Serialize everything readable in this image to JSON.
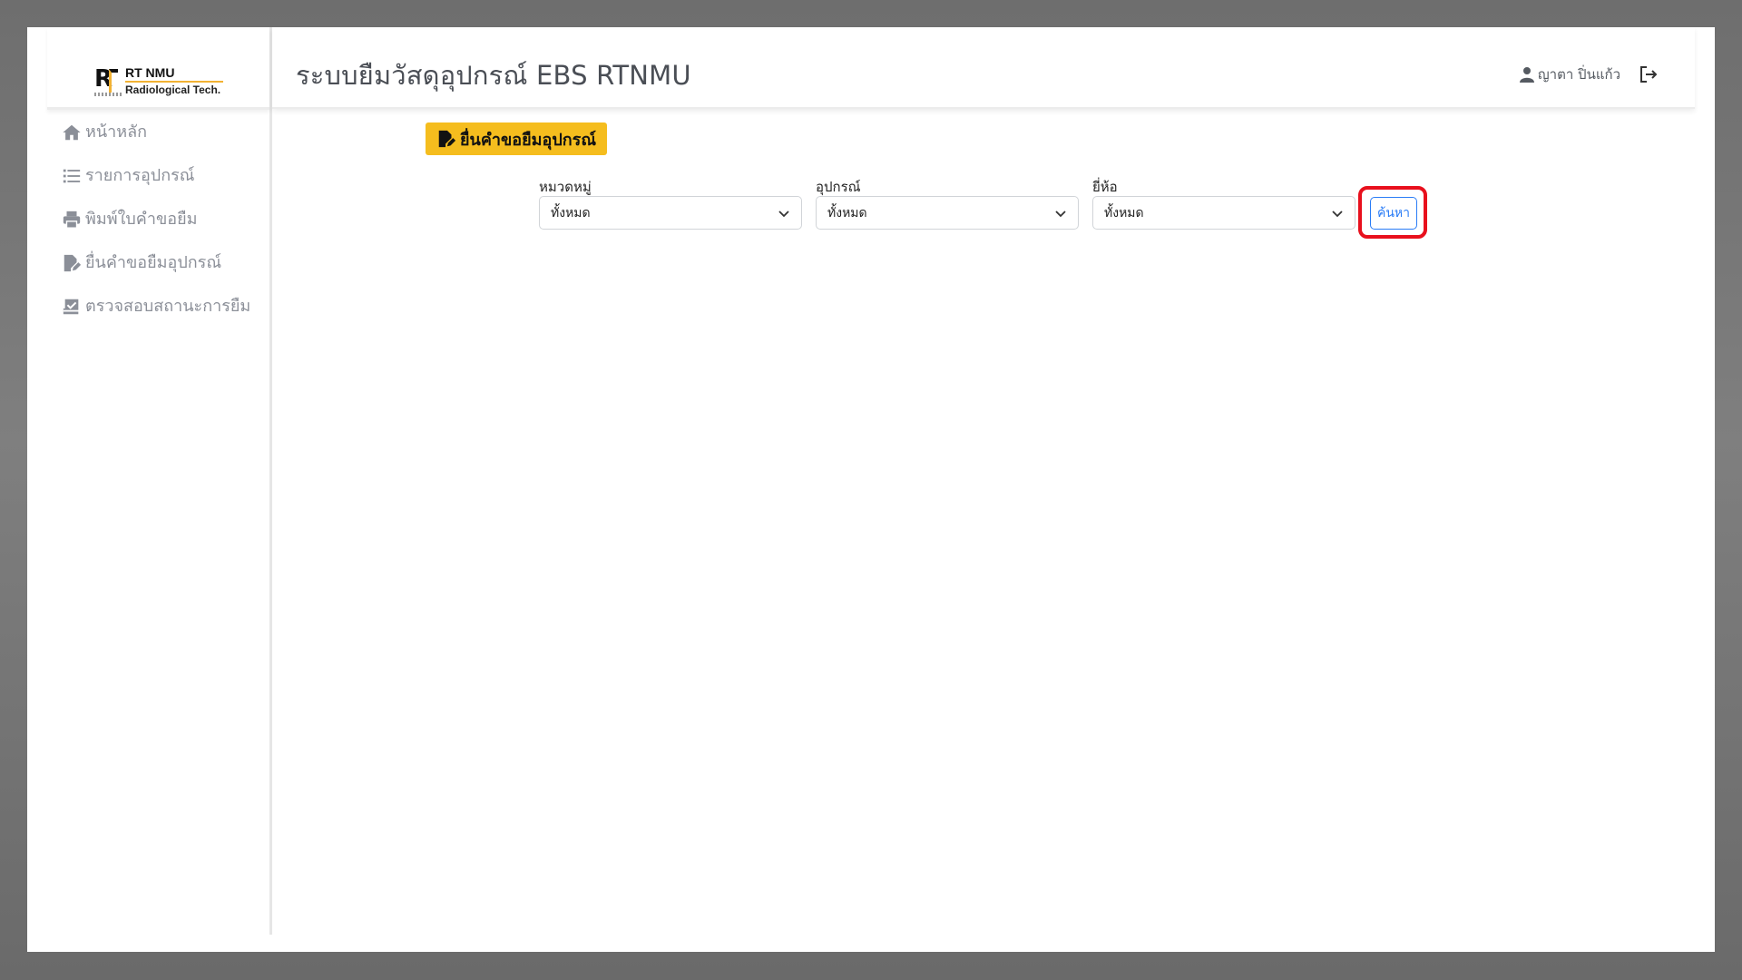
{
  "brand": {
    "title": "RT NMU",
    "subtitle": "Radiological Tech.",
    "accent_color": "#f2b233"
  },
  "sidebar": {
    "items": [
      {
        "label": "หน้าหลัก",
        "icon": "home-icon"
      },
      {
        "label": "รายการอุปกรณ์",
        "icon": "list-icon"
      },
      {
        "label": "พิมพ์ใบคำขอยืม",
        "icon": "printer-icon"
      },
      {
        "label": "ยื่นคำขอยืมอุปกรณ์",
        "icon": "file-edit-icon"
      },
      {
        "label": "ตรวจสอบสถานะการยืม",
        "icon": "inbox-check-icon"
      }
    ]
  },
  "header": {
    "title": "ระบบยืมวัสดุอุปกรณ์ EBS RTNMU",
    "user_name": "ญาตา ปิ่นแก้ว"
  },
  "main": {
    "request_button": "ยื่นคำขอยืมอุปกรณ์",
    "request_button_color": "#f5bd1e",
    "filters": [
      {
        "label": "หมวดหมู่",
        "value": "ทั้งหมด"
      },
      {
        "label": "อุปกรณ์",
        "value": "ทั้งหมด"
      },
      {
        "label": "ยี่ห้อ",
        "value": "ทั้งหมด"
      }
    ],
    "search_button": "ค้นหา",
    "search_button_color": "#2a7cf6",
    "highlight_color": "#e8101d"
  }
}
